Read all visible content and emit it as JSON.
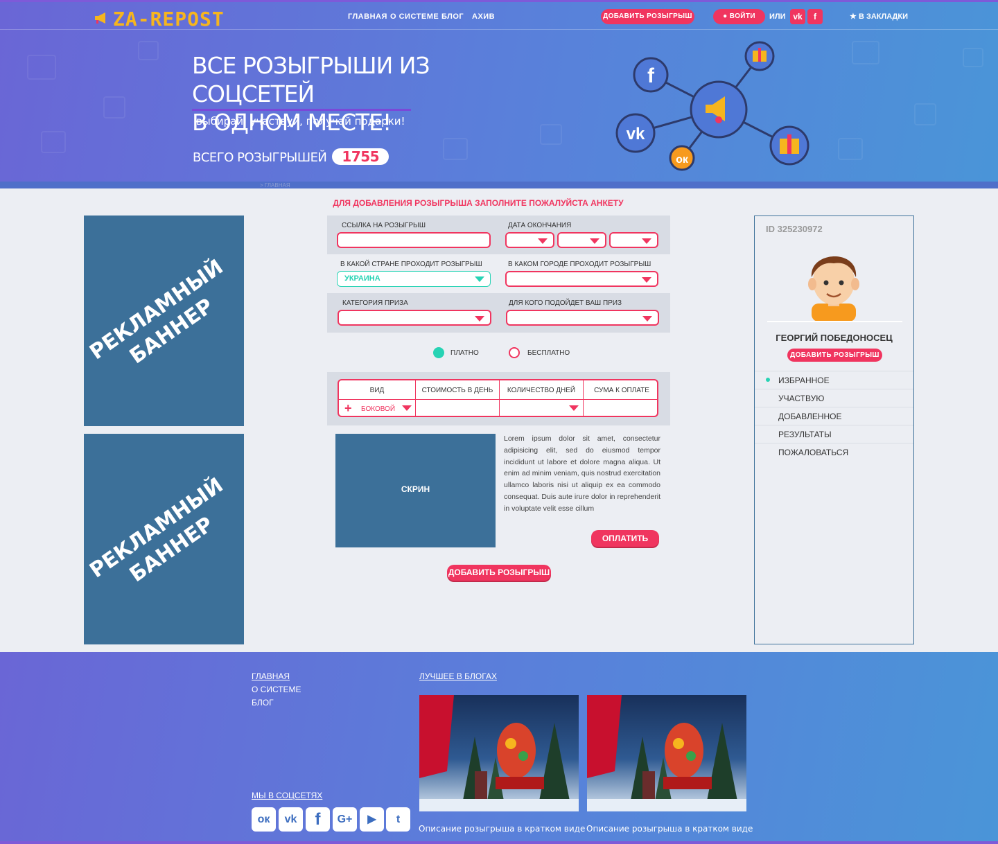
{
  "header": {
    "logo": "ZA-REPOST",
    "nav": [
      "ГЛАВНАЯ",
      "О СИСТЕМЕ",
      "БЛОГ",
      "АХИВ"
    ],
    "add_button": "ДОБАВИТЬ РОЗЫГРЫШ",
    "login_button": "ВОЙТИ",
    "or": "ИЛИ",
    "social_vk": "vk",
    "social_fb": "f",
    "bookmarks": "В ЗАКЛАДКИ"
  },
  "hero": {
    "title_line1": "ВСЕ РОЗЫГРЫШИ ИЗ СОЦСЕТЕЙ",
    "title_line2": "В ОДНОМ МЕСТЕ!",
    "subtitle": "выбирай, участвуй, получай подарки!",
    "count_label": "ВСЕГО РОЗЫГРЫШЕЙ",
    "count_value": "1755",
    "network_nodes": [
      "facebook-icon",
      "vk-icon",
      "odnoklassniki-icon",
      "gift-icon",
      "gift-icon",
      "megaphone-icon"
    ]
  },
  "breadcrumb": "> ГЛАВНАЯ",
  "ads": {
    "banner1": "РЕКЛАМНЫЙ БАННЕР",
    "banner2": "РЕКЛАМНЫЙ БАННЕР"
  },
  "form": {
    "title": "ДЛЯ ДОБАВЛЕНИЯ РОЗЫГРЫША ЗАПОЛНИТЕ ПОЖАЛУЙСТА АНКЕТУ",
    "link_label": "ССЫЛКА НА РОЗЫГРЫШ",
    "link_value": "",
    "date_label": "ДАТА ОКОНЧАНИЯ",
    "country_label": "В КАКОЙ СТРАНЕ ПРОХОДИТ РОЗЫГРЫШ",
    "country_value": "УКРАИНА",
    "city_label": "В КАКОМ ГОРОДЕ ПРОХОДИТ РОЗЫГРЫШ",
    "category_label": "КАТЕГОРИЯ ПРИЗА",
    "audience_label": "ДЛЯ КОГО ПОДОЙДЕТ ВАШ ПРИЗ",
    "paid_label": "ПЛАТНО",
    "free_label": "БЕСПЛАТНО",
    "selected_payment": "paid",
    "table": {
      "headers": [
        "ВИД",
        "СТОИМОСТЬ В ДЕНЬ",
        "КОЛИЧЕСТВО ДНЕЙ",
        "СУМА К ОПЛАТЕ"
      ],
      "row": {
        "type": "БОКОВОЙ",
        "plus": "+"
      }
    },
    "screen_label": "СКРИН",
    "lorem": "Lorem ipsum dolor sit amet, consectetur adipisicing elit, sed do eiusmod tempor incididunt ut labore et dolore magna aliqua. Ut enim ad minim veniam, quis nostrud exercitation ullamco laboris nisi ut aliquip ex ea commodo consequat. Duis aute irure dolor in reprehenderit in voluptate velit esse cillum",
    "pay_button": "ОПЛАТИТЬ",
    "submit_button": "ДОБАВИТЬ РОЗЫГРЫШ"
  },
  "profile": {
    "id": "ID 325230972",
    "name": "ГЕОРГИЙ ПОБЕДОНОСЕЦ",
    "add_button": "ДОБАВИТЬ РОЗЫГРЫШ",
    "menu": [
      "ИЗБРАННОЕ",
      "УЧАСТВУЮ",
      "ДОБАВЛЕННОЕ",
      "РЕЗУЛЬТАТЫ",
      "ПОЖАЛОВАТЬСЯ"
    ],
    "active_menu": "ИЗБРАННОЕ"
  },
  "footer": {
    "links": [
      "ГЛАВНАЯ",
      "О СИСТЕМЕ",
      "БЛОГ"
    ],
    "social_title": "МЫ В СОЦСЕТЯХ",
    "socials": [
      "odnoklassniki-icon",
      "vk-icon",
      "facebook-icon",
      "google-plus-icon",
      "youtube-icon",
      "twitter-icon"
    ],
    "social_glyphs": [
      "ок",
      "vk",
      "f",
      "G+",
      "▶",
      "t"
    ],
    "blog_title": "ЛУЧШЕЕ В БЛОГАХ",
    "blog_captions": [
      "Описание розыгрыша в кратком виде",
      "Описание розыгрыша в кратком виде"
    ]
  },
  "colors": {
    "accent": "#f0355f",
    "green": "#27d3b4",
    "banner": "#3c7099",
    "logo": "#f6b51e"
  }
}
